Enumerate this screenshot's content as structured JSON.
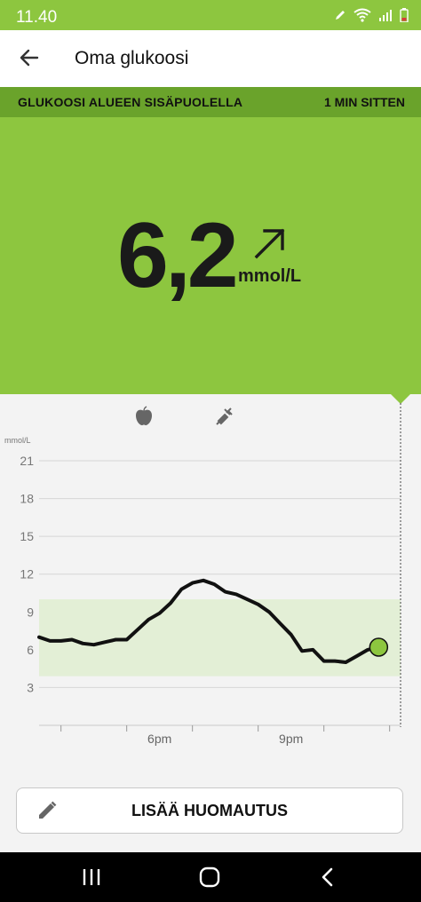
{
  "status_bar": {
    "time": "11.40"
  },
  "app_bar": {
    "title": "Oma glukoosi"
  },
  "banner": {
    "status": "GLUKOOSI ALUEEN SISÄPUOLELLA",
    "age": "1 MIN SITTEN"
  },
  "reading": {
    "value": "6,2",
    "unit": "mmol/L",
    "trend": "rising"
  },
  "colors": {
    "accent_green": "#8dc63f",
    "banner_green": "#6aa32b",
    "target_band": "#e3efd6"
  },
  "chart_data": {
    "type": "line",
    "ylabel": "mmol/L",
    "y_ticks": [
      3,
      6,
      9,
      12,
      15,
      18,
      21
    ],
    "ylim": [
      0,
      21
    ],
    "x_tick_labels": [
      "6pm",
      "9pm"
    ],
    "target_range": [
      3.9,
      10
    ],
    "x_minutes": [
      0,
      10,
      20,
      30,
      40,
      50,
      60,
      70,
      80,
      90,
      100,
      110,
      120,
      130,
      140,
      150,
      160,
      170,
      180,
      190,
      200,
      210,
      220,
      230,
      240,
      250,
      260,
      270,
      280,
      290,
      300,
      310,
      320,
      330
    ],
    "values": [
      7.0,
      6.7,
      6.7,
      6.8,
      6.5,
      6.4,
      6.6,
      6.8,
      6.8,
      7.6,
      8.4,
      8.9,
      9.7,
      10.8,
      11.3,
      11.5,
      11.2,
      10.6,
      10.4,
      10.0,
      9.6,
      9.0,
      8.1,
      7.2,
      5.9,
      6.0,
      5.1,
      5.1,
      5.0,
      5.5,
      6.0,
      6.2
    ],
    "current_value": 6.2,
    "event_icons": [
      "apple-icon",
      "syringe-icon"
    ]
  },
  "note_button": {
    "label": "LISÄÄ HUOMAUTUS"
  }
}
